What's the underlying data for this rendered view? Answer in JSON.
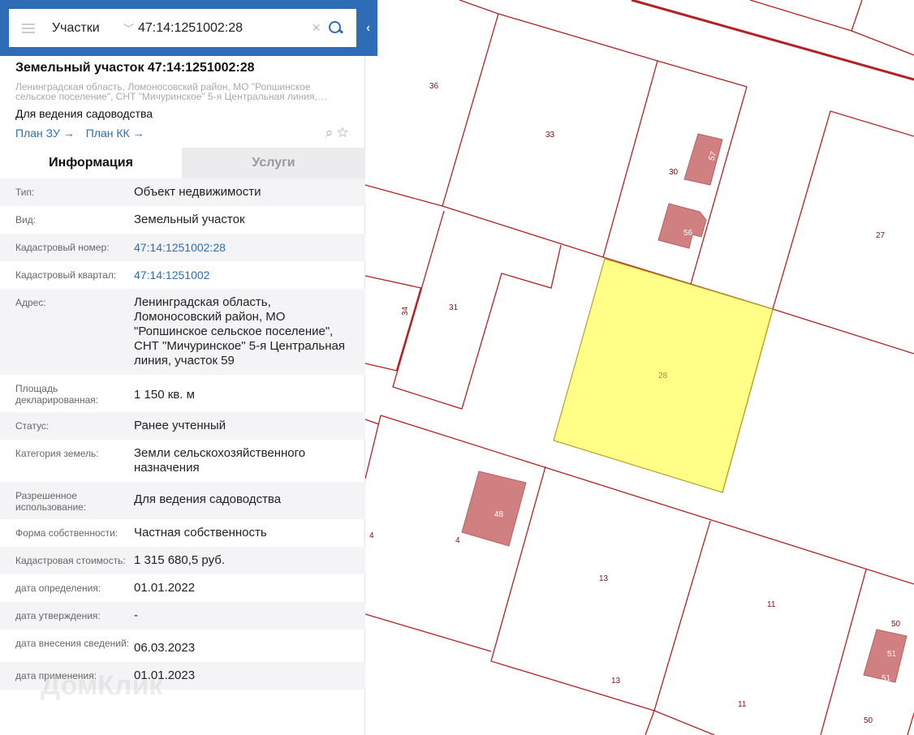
{
  "search": {
    "category": "Участки",
    "query": "47:14:1251002:28"
  },
  "header": {
    "title": "Земельный участок 47:14:1251002:28",
    "address_line1": "Ленинградская область, Ломоносовский район, МО \"Ропшинское",
    "address_line2": "сельское поселение\", СНТ \"Мичуринское\" 5-я Центральная линия,…",
    "purpose": "Для ведения садоводства",
    "link_plan_zu": "План ЗУ →",
    "link_plan_kk": "План КК →"
  },
  "tabs": {
    "info": "Информация",
    "services": "Услуги"
  },
  "rows": [
    {
      "label": "Тип:",
      "value": "Объект недвижимости"
    },
    {
      "label": "Вид:",
      "value": "Земельный участок"
    },
    {
      "label": "Кадастровый номер:",
      "value": "47:14:1251002:28"
    },
    {
      "label": "Кадастровый квартал:",
      "value": "47:14:1251002"
    },
    {
      "label": "Адрес:",
      "value": "Ленинградская область, Ломоносовский район, МО \"Ропшинское сельское поселение\", СНТ \"Мичуринское\" 5-я Центральная линия, участок 59"
    },
    {
      "label": "Площадь декларированная:",
      "value": "1 150 кв. м"
    },
    {
      "label": "Статус:",
      "value": "Ранее учтенный"
    },
    {
      "label": "Категория земель:",
      "value": "Земли сельскохозяйственного назначения"
    },
    {
      "label": "Разрешенное использование:",
      "value": "Для ведения садоводства"
    },
    {
      "label": "Форма собственности:",
      "value": "Частная собственность"
    },
    {
      "label": "Кадастровая стоимость:",
      "value": "1 315 680,5 руб."
    },
    {
      "label": "дата определения:",
      "value": "01.01.2022"
    },
    {
      "label": "дата утверждения:",
      "value": "-"
    },
    {
      "label": "дата внесения сведений:",
      "value": "06.03.2023"
    },
    {
      "label": "дата применения:",
      "value": "01.01.2023"
    }
  ],
  "watermark": "ДомКлик",
  "map": {
    "labels": [
      "36",
      "33",
      "30",
      "57",
      "56",
      "27",
      "34",
      "31",
      "28",
      "48",
      "4",
      "4",
      "13",
      "13",
      "11",
      "11",
      "50",
      "51",
      "51",
      "50"
    ],
    "colors": {
      "boundary": "#b22222",
      "selected": "#ffff88",
      "building": "#d08080"
    }
  }
}
